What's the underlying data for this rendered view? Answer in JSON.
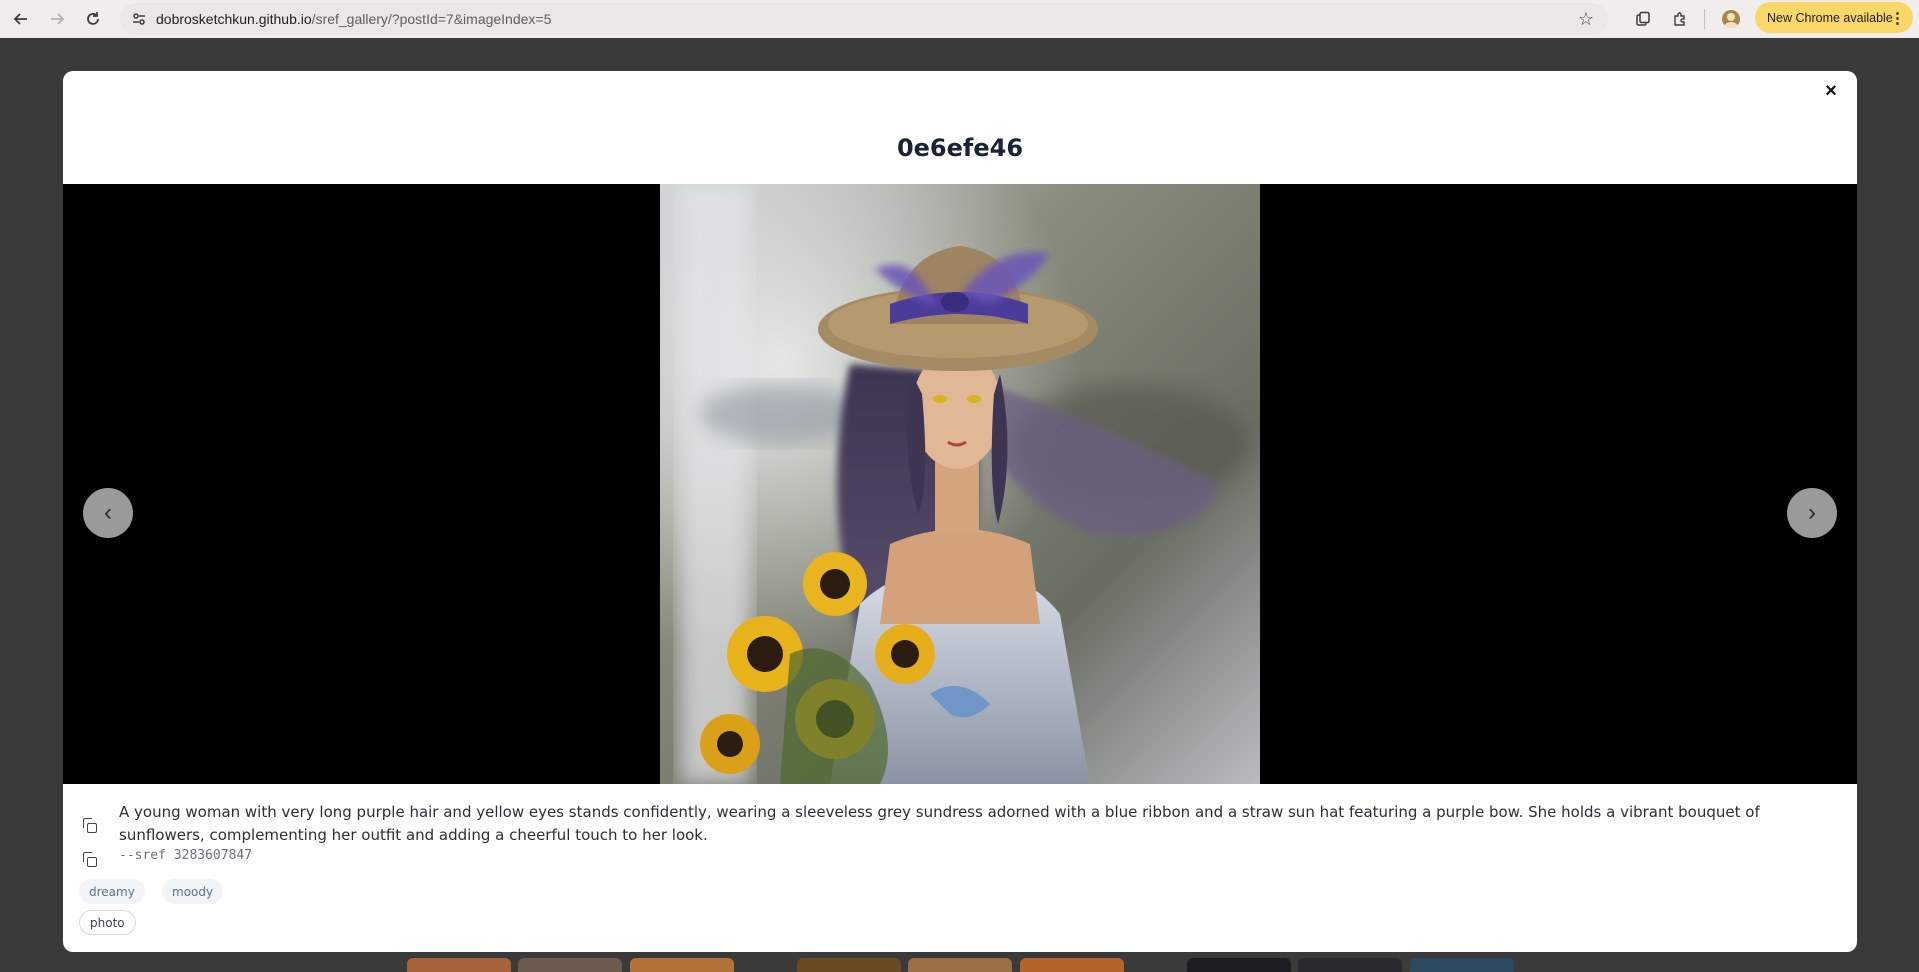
{
  "browser": {
    "url_host": "dobrosketchkun.github.io",
    "url_path": "/sref_gallery/?postId=7&imageIndex=5",
    "update_label": "New Chrome available",
    "icons": [
      "back-arrow-icon",
      "forward-arrow-icon",
      "reload-icon",
      "site-settings-icon",
      "star-icon",
      "tab-search-icon",
      "extensions-icon",
      "profile-icon",
      "more-vert-icon"
    ]
  },
  "modal": {
    "title": "0e6efe46",
    "close_label": "×",
    "prev_label": "‹",
    "next_label": "›",
    "prompt": "A young woman with very long purple hair and yellow eyes stands confidently, wearing a sleeveless grey sundress adorned with a blue ribbon and a straw sun hat featuring a purple bow. She holds a vibrant bouquet of sunflowers, complementing her outfit and adding a cheerful touch to her look.",
    "sref": "--sref 3283607847",
    "tags": [
      "dreamy",
      "moody",
      "photo"
    ]
  },
  "colors": {
    "backdrop": "#3a3a3a",
    "modal_bg": "#ffffff",
    "viewer_bg": "#000000",
    "update_pill": "#fbd76a"
  }
}
